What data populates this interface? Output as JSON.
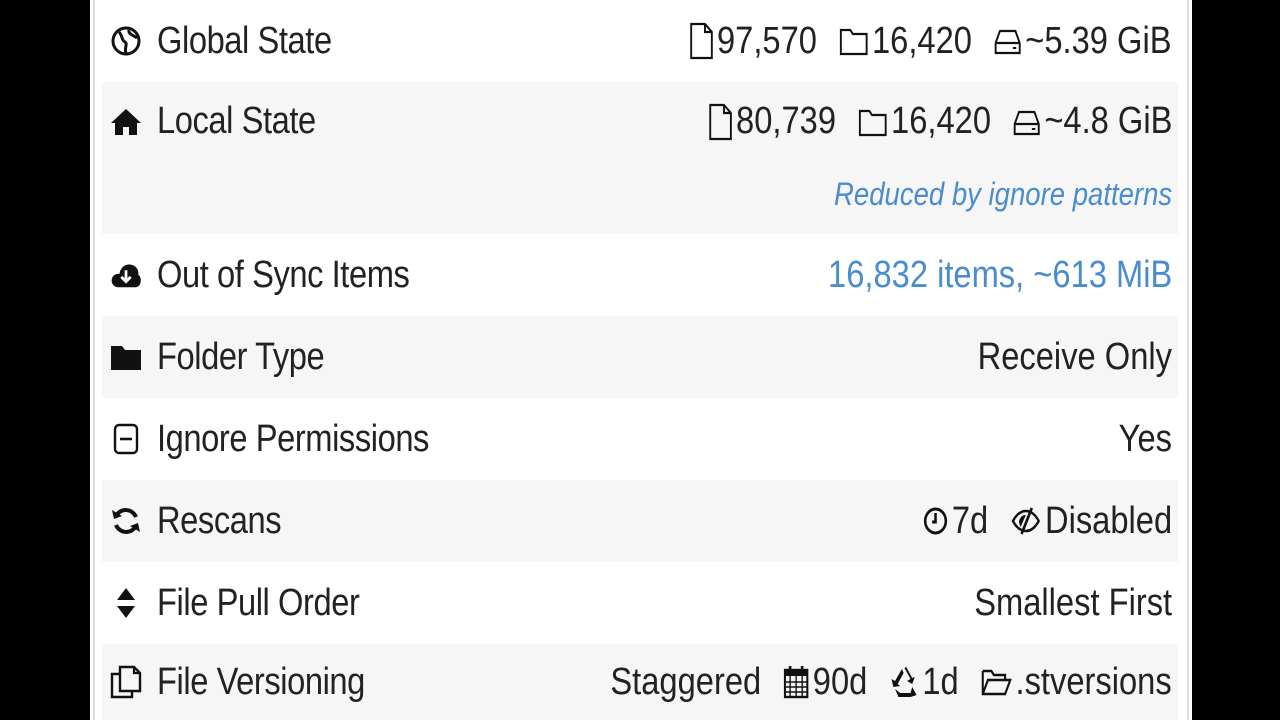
{
  "rows": {
    "global_state": {
      "label": "Global State",
      "files": "97,570",
      "folders": "16,420",
      "size": "~5.39 GiB",
      "icon": "globe-icon"
    },
    "local_state": {
      "label": "Local State",
      "files": "80,739",
      "folders": "16,420",
      "size": "~4.8 GiB",
      "note": "Reduced by ignore patterns",
      "icon": "home-icon"
    },
    "out_of_sync": {
      "label": "Out of Sync Items",
      "value": "16,832 items, ~613 MiB",
      "icon": "cloud-download-icon"
    },
    "folder_type": {
      "label": "Folder Type",
      "value": "Receive Only",
      "icon": "folder-icon"
    },
    "ignore_permissions": {
      "label": "Ignore Permissions",
      "value": "Yes",
      "icon": "minus-square-icon"
    },
    "rescans": {
      "label": "Rescans",
      "interval": "7d",
      "watch": "Disabled",
      "icon": "refresh-icon"
    },
    "file_pull_order": {
      "label": "File Pull Order",
      "value": "Smallest First",
      "icon": "sort-icon"
    },
    "file_versioning": {
      "label": "File Versioning",
      "type": "Staggered",
      "max_age": "90d",
      "cleanup": "1d",
      "path": ".stversions",
      "icon": "copy-icon"
    }
  },
  "colors": {
    "link": "#4a8ccc",
    "row_shade": "#f6f6f6",
    "text": "#222222"
  }
}
